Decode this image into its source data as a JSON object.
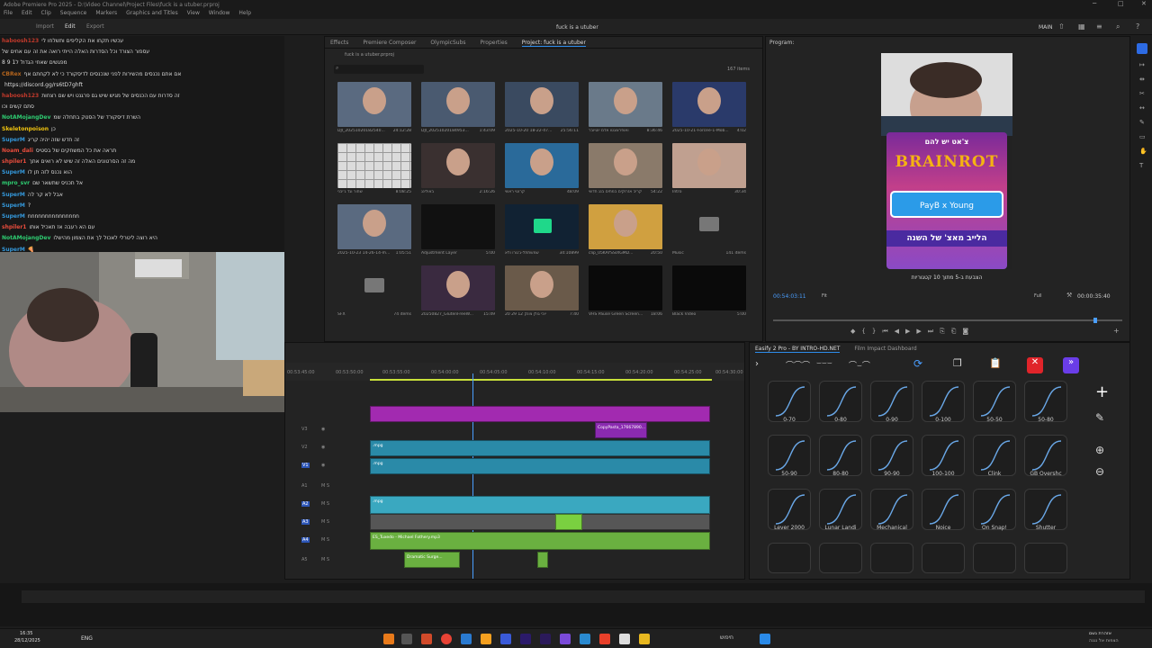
{
  "window": {
    "title": "Adobe Premiere Pro 2025 - D:\\Video Channel\\Project Files\\fuck is a utuber.prproj",
    "center_title": "fuck is a utuber",
    "workspace": "MAIN"
  },
  "menu": [
    "File",
    "Edit",
    "Clip",
    "Sequence",
    "Markers",
    "Graphics and Titles",
    "View",
    "Window",
    "Help"
  ],
  "nav": {
    "import": "Import",
    "edit": "Edit",
    "export": "Export"
  },
  "chat": [
    {
      "u": "haboosh123",
      "c": "#c0392b",
      "t": "עכשיו תקחו את הקליפים ותשלחו לי"
    },
    {
      "u": "",
      "c": "#fff",
      "t": "עספור הצורד וכל הסדרות האלה הייתי רואה את זה עם אחים של"
    },
    {
      "u": "",
      "c": "#fff",
      "t": "מפגשים שאחי הגדול ל1 9 8"
    },
    {
      "u": "CBRex",
      "c": "#b5651d",
      "t": "אם אתם נכנסים מהשירות לפני שנכנסים לדיסקורד כי לא לקחתם אף"
    },
    {
      "u": "",
      "c": "#fff",
      "t": "https://discord.gg/rs6tD7ghft"
    },
    {
      "u": "haboosh123",
      "c": "#c0392b",
      "t": "זה סדרות עם הכנסים של מגיש שיש גם פרגנט ויש שם רצחות"
    },
    {
      "u": "",
      "c": "#fff",
      "t": "סתם קשים וכו"
    },
    {
      "u": "NotAMojangDev",
      "c": "#2ecc71",
      "t": "השרת דיסקורד של הסטק בתחלה שמ"
    },
    {
      "u": "Skeletonpoison",
      "c": "#f1c40f",
      "t": "כן"
    },
    {
      "u": "SuperM",
      "c": "#3498db",
      "t": "זה חדש שזה יהיה קריג"
    },
    {
      "u": "Noam_dali",
      "c": "#e74c3c",
      "t": "תראה את כל המשחקים של בסטיס"
    },
    {
      "u": "shpiler1",
      "c": "#e74c3c",
      "t": "מה זה הסרטונים האלה זה שיש לא רואים אתך"
    },
    {
      "u": "SuperM",
      "c": "#3498db",
      "t": "הוא נכנס לזה תן לו"
    },
    {
      "u": "mpro_svr",
      "c": "#2ecc71",
      "t": "אל תכניס שתשאר שם"
    },
    {
      "u": "SuperM",
      "c": "#3498db",
      "t": "אבל לא קר לה"
    },
    {
      "u": "SuperM",
      "c": "#3498db",
      "t": "?"
    },
    {
      "u": "SuperM",
      "c": "#3498db",
      "t": "nnnnnnnnnnnnnnn"
    },
    {
      "u": "shpiler1",
      "c": "#e74c3c",
      "t": "עם הא רעבה אז תאכיל אותו"
    },
    {
      "u": "NotAMojangDev",
      "c": "#2ecc71",
      "t": "היא רוצה ליטרלי לאכול לך את הצמון מהישלו"
    },
    {
      "u": "SuperM",
      "c": "#3498db",
      "t": "🍕"
    },
    {
      "u": "SuperM",
      "c": "#3498db",
      "t": "🍕"
    },
    {
      "u": "Noam_dali",
      "c": "#e74c3c",
      "t": "🍕"
    }
  ],
  "project": {
    "tabs": [
      "Effects",
      "Premiere Composer",
      "OlympicSubs",
      "Properties",
      "Project: fuck is a utuber"
    ],
    "file": "fuck is a utuber.prproj",
    "count": "167 items",
    "items": [
      {
        "n": "DJI_20251020182540...",
        "d": "24:12:28"
      },
      {
        "n": "DJI_20251020184953...",
        "d": "1:43:09"
      },
      {
        "n": "2025-10-20 18-22-47...",
        "d": "25:56:11"
      },
      {
        "n": "ואופרצוגטו אדם יוטיובר",
        "d": "8:36:46"
      },
      {
        "n": "2025-10-21-Forcee-1-Mob...",
        "d": "4:02"
      },
      {
        "n": "שחור וגד ג'יבני",
        "d": "8:08:25"
      },
      {
        "n": "באולינג",
        "d": "2:16:26"
      },
      {
        "n": "קרוטי ראשי",
        "d": "48:09"
      },
      {
        "n": "קריב אזרוקים במתים בנג חדשי",
        "d": "54:22"
      },
      {
        "n": "Intro",
        "d": "30:34"
      },
      {
        "n": "2025-10-23 14-26-14-m...",
        "d": "1:05:51"
      },
      {
        "n": "Adjustment Layer",
        "d": "5:00"
      },
      {
        "n": "שמשתתל-ג'גורו ולא",
        "d": "34:10899"
      },
      {
        "n": "clip_05KAYSSIXGMD...",
        "d": "20:50"
      },
      {
        "n": "Music",
        "d": "141 items"
      },
      {
        "n": "SFX",
        "d": "74 items"
      },
      {
        "n": "20250827_GlutenFreeW...",
        "d": "15:49"
      },
      {
        "n": "20 29 12 יוכי גולן צונק",
        "d": "7:40"
      },
      {
        "n": "VHS Pause Green Screen...",
        "d": "18:06"
      },
      {
        "n": "Black Video",
        "d": "5:00"
      }
    ]
  },
  "program": {
    "tab": "Program:",
    "title_he": "צ'אט יש להם",
    "brand": "BRAINROT",
    "payb": "PayB x Young",
    "live_he": "הלייב מאצ' של השנה",
    "sub_he": "הצבעת ב-5 מתוך 10 קטגוריות",
    "timecode": "00:54:03:11",
    "fit": "Fit",
    "full": "Full",
    "duration": "00:00:35:40"
  },
  "timeline": {
    "ruler": [
      "00:53:45:00",
      "00:53:50:00",
      "00:53:55:00",
      "00:54:00:00",
      "00:54:05:00",
      "00:54:10:00",
      "00:54:15:00",
      "00:54:20:00",
      "00:54:25:00",
      "00:54:30:00"
    ],
    "tracks": [
      "V3",
      "V2",
      "V1",
      "A1",
      "A2",
      "A3",
      "A4",
      "A5"
    ],
    "copypasta": "CopyPasta_17667890...",
    "music": "ES_Tuxedo - Michael Fothery.mp3",
    "dramatic": "Dramatic Surge...",
    "mpg": ".mpg"
  },
  "easify": {
    "tabs": [
      "Easify 2 Pro - BY INTRO-HD.NET",
      "Film Impact Dashboard"
    ],
    "presets": [
      "0-70",
      "0-80",
      "0-90",
      "0-100",
      "50-50",
      "50-80",
      "50-90",
      "80-80",
      "90-90",
      "100-100",
      "Clink",
      "GB Overshc",
      "Lever 2000",
      "Lunar Landi",
      "Mechanical",
      "Noice",
      "On Snap!",
      "Shutter"
    ]
  },
  "taskbar": {
    "time": "16:35",
    "date": "28/12/2025",
    "lang": "ENG",
    "search": "חיפוש",
    "notice": "אזהרת גשם",
    "notice2": "הצפות אל נגנה"
  }
}
